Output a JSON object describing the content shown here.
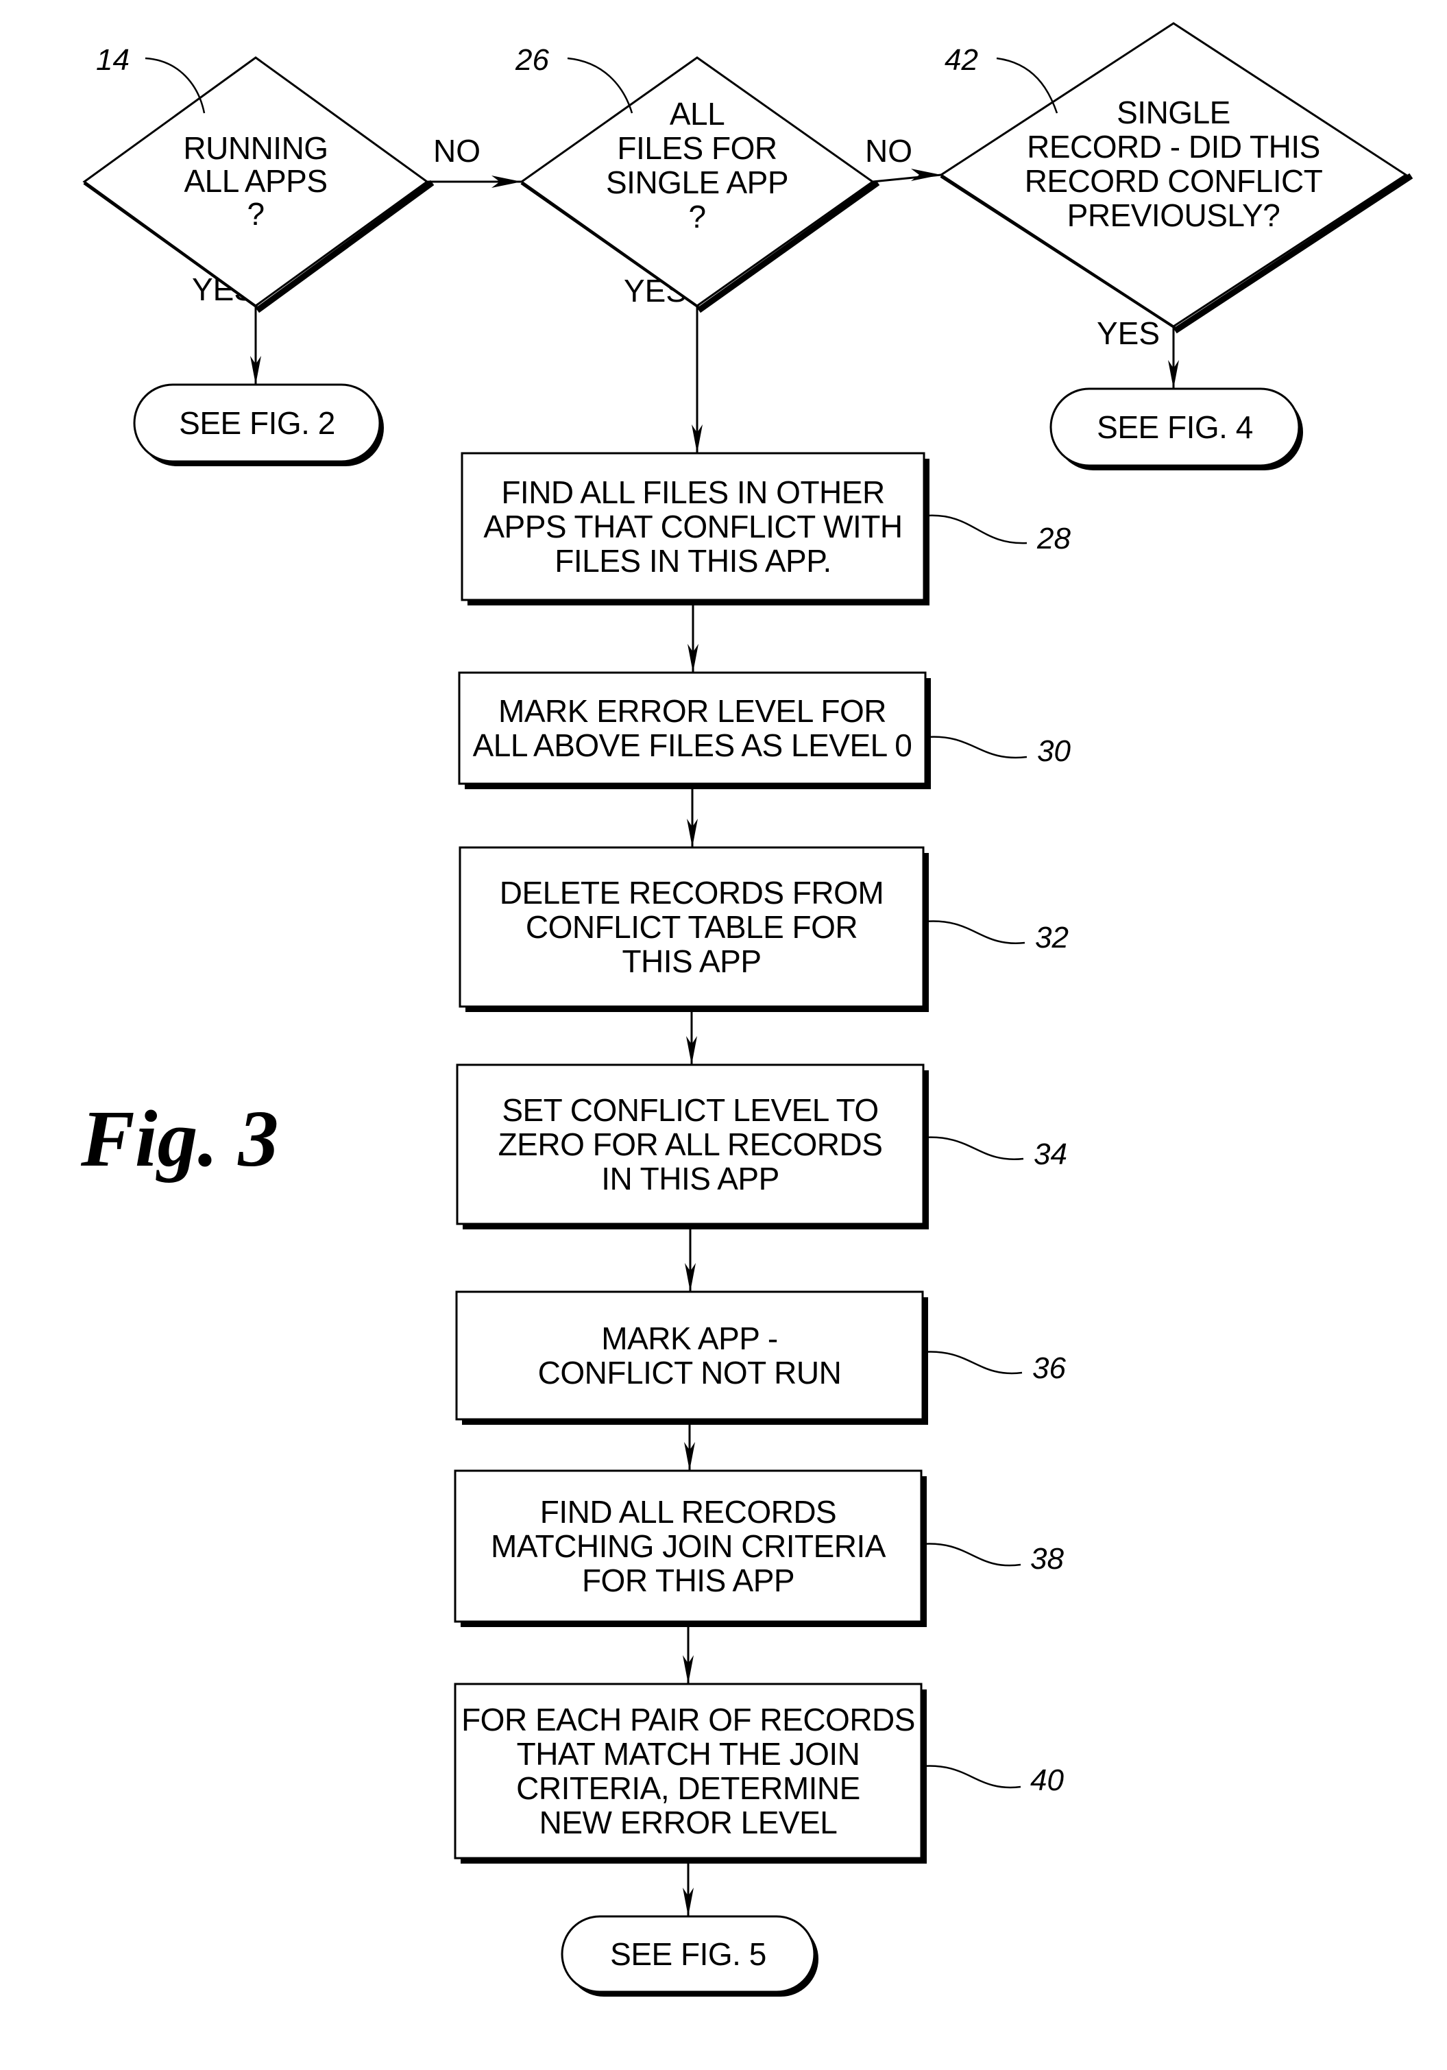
{
  "figure": {
    "label": "Fig. 3"
  },
  "nodes": [
    {
      "id": "14",
      "type": "decision",
      "ref": "14",
      "lines": [
        "RUNNING",
        "ALL APPS",
        "?"
      ]
    },
    {
      "id": "26",
      "type": "decision",
      "ref": "26",
      "lines": [
        "ALL",
        "FILES FOR",
        "SINGLE APP",
        "?"
      ]
    },
    {
      "id": "42",
      "type": "decision",
      "ref": "42",
      "lines": [
        "SINGLE",
        "RECORD - DID THIS",
        "RECORD CONFLICT",
        "PREVIOUSLY?"
      ]
    },
    {
      "id": "fig2",
      "type": "terminal",
      "lines": [
        "SEE FIG. 2"
      ]
    },
    {
      "id": "fig4",
      "type": "terminal",
      "lines": [
        "SEE FIG. 4"
      ]
    },
    {
      "id": "28",
      "type": "process",
      "ref": "28",
      "lines": [
        "FIND ALL FILES IN OTHER",
        "APPS THAT CONFLICT WITH",
        "FILES IN THIS APP."
      ]
    },
    {
      "id": "30",
      "type": "process",
      "ref": "30",
      "lines": [
        "MARK ERROR LEVEL FOR",
        "ALL ABOVE FILES AS LEVEL 0"
      ]
    },
    {
      "id": "32",
      "type": "process",
      "ref": "32",
      "lines": [
        "DELETE RECORDS FROM",
        "CONFLICT TABLE FOR",
        "THIS APP"
      ]
    },
    {
      "id": "34",
      "type": "process",
      "ref": "34",
      "lines": [
        "SET CONFLICT LEVEL TO",
        "ZERO FOR ALL RECORDS",
        "IN THIS APP"
      ]
    },
    {
      "id": "36",
      "type": "process",
      "ref": "36",
      "lines": [
        "MARK APP -",
        "CONFLICT NOT RUN"
      ]
    },
    {
      "id": "38",
      "type": "process",
      "ref": "38",
      "lines": [
        "FIND ALL RECORDS",
        "MATCHING JOIN CRITERIA",
        "FOR THIS APP"
      ]
    },
    {
      "id": "40",
      "type": "process",
      "ref": "40",
      "lines": [
        "FOR EACH PAIR OF RECORDS",
        "THAT MATCH THE JOIN",
        "CRITERIA, DETERMINE",
        "NEW ERROR LEVEL"
      ]
    },
    {
      "id": "fig5",
      "type": "terminal",
      "lines": [
        "SEE FIG. 5"
      ]
    }
  ],
  "edges": [
    {
      "from": "14",
      "to": "26",
      "label": "NO"
    },
    {
      "from": "26",
      "to": "42",
      "label": "NO"
    },
    {
      "from": "14",
      "to": "fig2",
      "label": "YES"
    },
    {
      "from": "26",
      "to": "28",
      "label": "YES"
    },
    {
      "from": "42",
      "to": "fig4",
      "label": "YES"
    },
    {
      "from": "28",
      "to": "30",
      "label": ""
    },
    {
      "from": "30",
      "to": "32",
      "label": ""
    },
    {
      "from": "32",
      "to": "34",
      "label": ""
    },
    {
      "from": "34",
      "to": "36",
      "label": ""
    },
    {
      "from": "36",
      "to": "38",
      "label": ""
    },
    {
      "from": "38",
      "to": "40",
      "label": ""
    },
    {
      "from": "40",
      "to": "fig5",
      "label": ""
    }
  ]
}
